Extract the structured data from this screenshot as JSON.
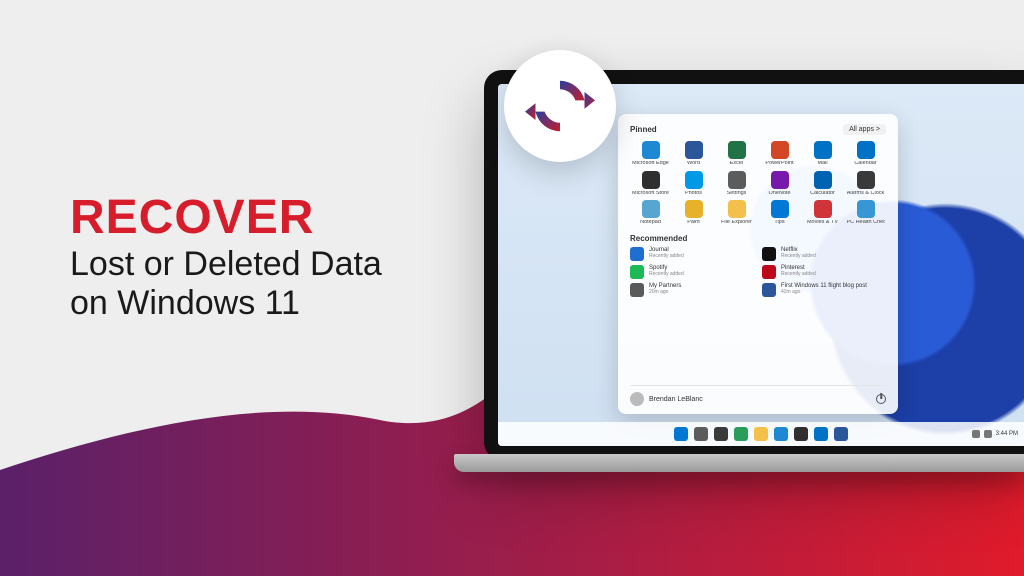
{
  "headline": {
    "title": "RECOVER",
    "line1": "Lost or Deleted Data",
    "line2": "on Windows 11"
  },
  "colors": {
    "accent_red": "#d71d2b",
    "gradient_start": "#5a2069",
    "gradient_end": "#e01b2b"
  },
  "start_menu": {
    "pinned_label": "Pinned",
    "all_apps_label": "All apps  >",
    "recommended_label": "Recommended",
    "apps": [
      {
        "name": "Microsoft Edge",
        "color": "#1e88d2"
      },
      {
        "name": "Word",
        "color": "#2b579a"
      },
      {
        "name": "Excel",
        "color": "#217346"
      },
      {
        "name": "PowerPoint",
        "color": "#d24726"
      },
      {
        "name": "Mail",
        "color": "#0072c6"
      },
      {
        "name": "Calendar",
        "color": "#0072c6"
      },
      {
        "name": "Microsoft Store",
        "color": "#2f2f2f"
      },
      {
        "name": "Photos",
        "color": "#0099e5"
      },
      {
        "name": "Settings",
        "color": "#5c5c5c"
      },
      {
        "name": "OneNote",
        "color": "#7719aa"
      },
      {
        "name": "Calculator",
        "color": "#0063b1"
      },
      {
        "name": "Alarms & Clock",
        "color": "#3a3a3a"
      },
      {
        "name": "Notepad",
        "color": "#57a5d1"
      },
      {
        "name": "Paint",
        "color": "#e8b12a"
      },
      {
        "name": "File Explorer",
        "color": "#f3c14b"
      },
      {
        "name": "Tips",
        "color": "#0078d4"
      },
      {
        "name": "Movies & TV",
        "color": "#d13438"
      },
      {
        "name": "PC Health Check",
        "color": "#3797d4"
      }
    ],
    "recommended": [
      {
        "name": "Journal",
        "sub": "Recently added",
        "color": "#1f6fd0"
      },
      {
        "name": "Netflix",
        "sub": "Recently added",
        "color": "#111111"
      },
      {
        "name": "Spotify",
        "sub": "Recently added",
        "color": "#1db954"
      },
      {
        "name": "Pinterest",
        "sub": "Recently added",
        "color": "#bd081c"
      },
      {
        "name": "My Partners",
        "sub": "20m ago",
        "color": "#5a5a5a"
      },
      {
        "name": "First Windows 11 flight blog post",
        "sub": "42m ago",
        "color": "#2b579a"
      }
    ],
    "user": "Brendan LeBlanc"
  },
  "taskbar": {
    "icons": [
      "start",
      "search",
      "taskview",
      "widgets",
      "explorer",
      "edge",
      "store",
      "mail",
      "word"
    ],
    "time": "3:44 PM"
  }
}
